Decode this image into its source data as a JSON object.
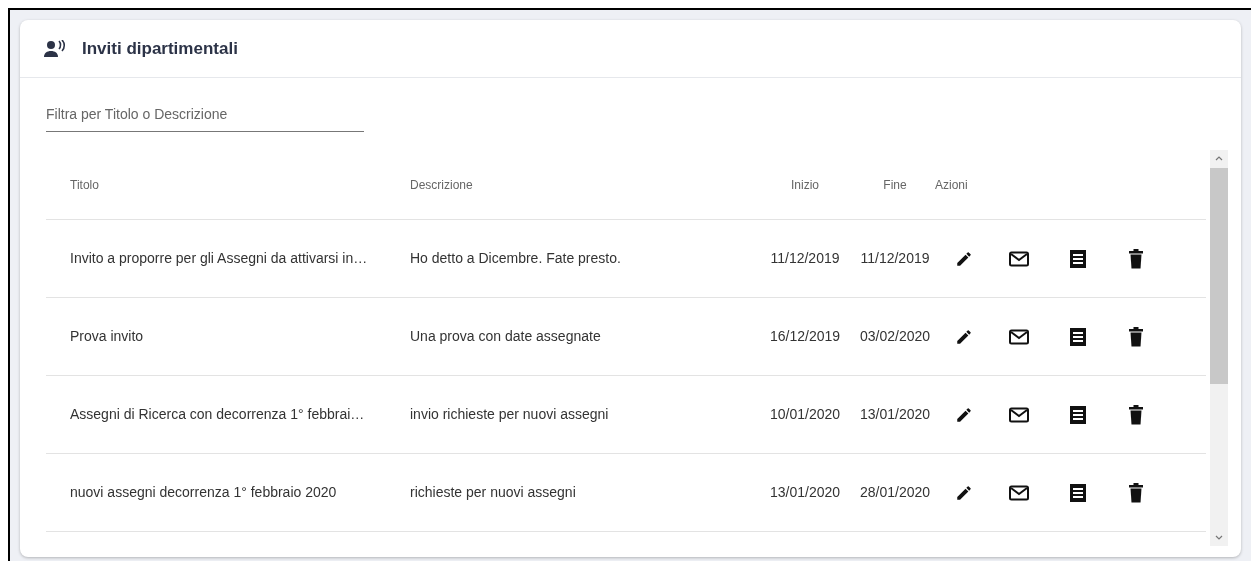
{
  "card": {
    "title": "Inviti dipartimentali"
  },
  "filter": {
    "placeholder": "Filtra per Titolo o Descrizione"
  },
  "table": {
    "columns": [
      "Titolo",
      "Descrizione",
      "Inizio",
      "Fine",
      "Azioni"
    ],
    "rows": [
      {
        "title": "Invito a proporre per gli Assegni da attivarsi in…",
        "description": "Ho detto a Dicembre. Fate presto.",
        "start": "11/12/2019",
        "end": "11/12/2019"
      },
      {
        "title": "Prova invito",
        "description": "Una prova con date assegnate",
        "start": "16/12/2019",
        "end": "03/02/2020"
      },
      {
        "title": "Assegni di Ricerca con decorrenza 1° febbrai…",
        "description": "invio richieste per nuovi assegni",
        "start": "10/01/2020",
        "end": "13/01/2020"
      },
      {
        "title": "nuovi assegni decorrenza 1° febbraio 2020",
        "description": "richieste per nuovi assegni",
        "start": "13/01/2020",
        "end": "28/01/2020"
      }
    ]
  }
}
